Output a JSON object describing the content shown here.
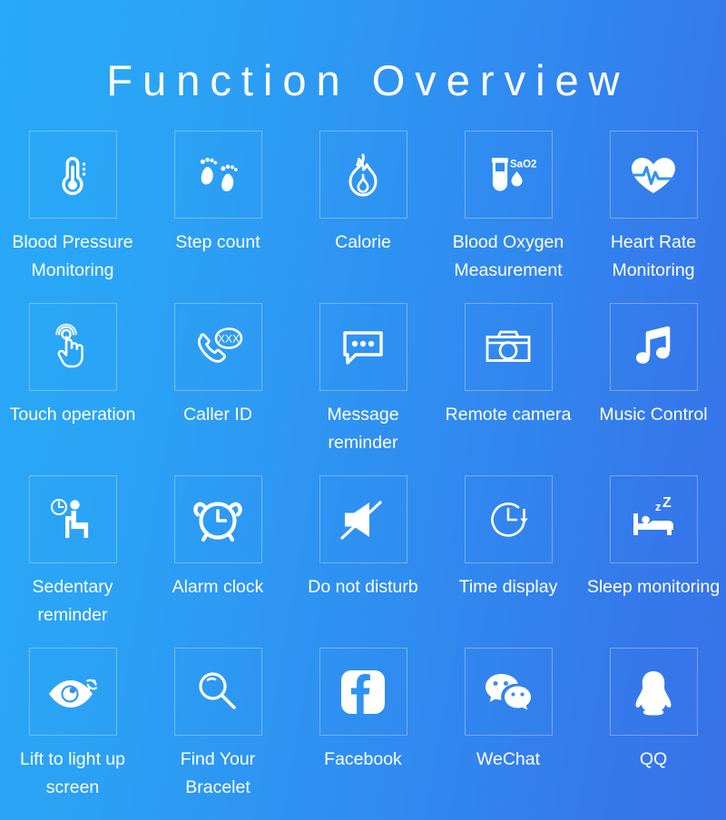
{
  "header": {
    "title": "Function Overview"
  },
  "theme": {
    "gradient_start": "#27AAF8",
    "gradient_end": "#3673E8",
    "text_color": "#FFFFFF",
    "box_border_color": "rgba(255,255,255,0.32)"
  },
  "features": [
    {
      "label": "Blood Pressure Monitoring",
      "icon": "thermometer-icon"
    },
    {
      "label": "Step count",
      "icon": "footprints-icon"
    },
    {
      "label": "Calorie",
      "icon": "flame-icon"
    },
    {
      "label": "Blood Oxygen Measurement",
      "icon": "test-tube-icon",
      "icon_text": "SaO2"
    },
    {
      "label": "Heart Rate Monitoring",
      "icon": "heartbeat-icon"
    },
    {
      "label": "Touch operation",
      "icon": "touch-hand-icon"
    },
    {
      "label": "Caller ID",
      "icon": "phone-call-icon",
      "icon_text": "XXX"
    },
    {
      "label": "Message reminder",
      "icon": "speech-bubble-icon"
    },
    {
      "label": "Remote camera",
      "icon": "camera-icon"
    },
    {
      "label": "Music Control",
      "icon": "music-note-icon"
    },
    {
      "label": "Sedentary reminder",
      "icon": "sitting-person-clock-icon"
    },
    {
      "label": "Alarm clock",
      "icon": "alarm-clock-icon"
    },
    {
      "label": "Do not disturb",
      "icon": "mute-speaker-icon"
    },
    {
      "label": "Time display",
      "icon": "clock-arrow-icon"
    },
    {
      "label": "Sleep monitoring",
      "icon": "bed-zzz-icon",
      "icon_text": "zZ"
    },
    {
      "label": "Lift to light up screen",
      "icon": "eye-refresh-icon"
    },
    {
      "label": "Find Your Bracelet",
      "icon": "magnifier-icon"
    },
    {
      "label": "Facebook",
      "icon": "facebook-icon"
    },
    {
      "label": "WeChat",
      "icon": "wechat-icon"
    },
    {
      "label": "QQ",
      "icon": "qq-penguin-icon"
    }
  ]
}
